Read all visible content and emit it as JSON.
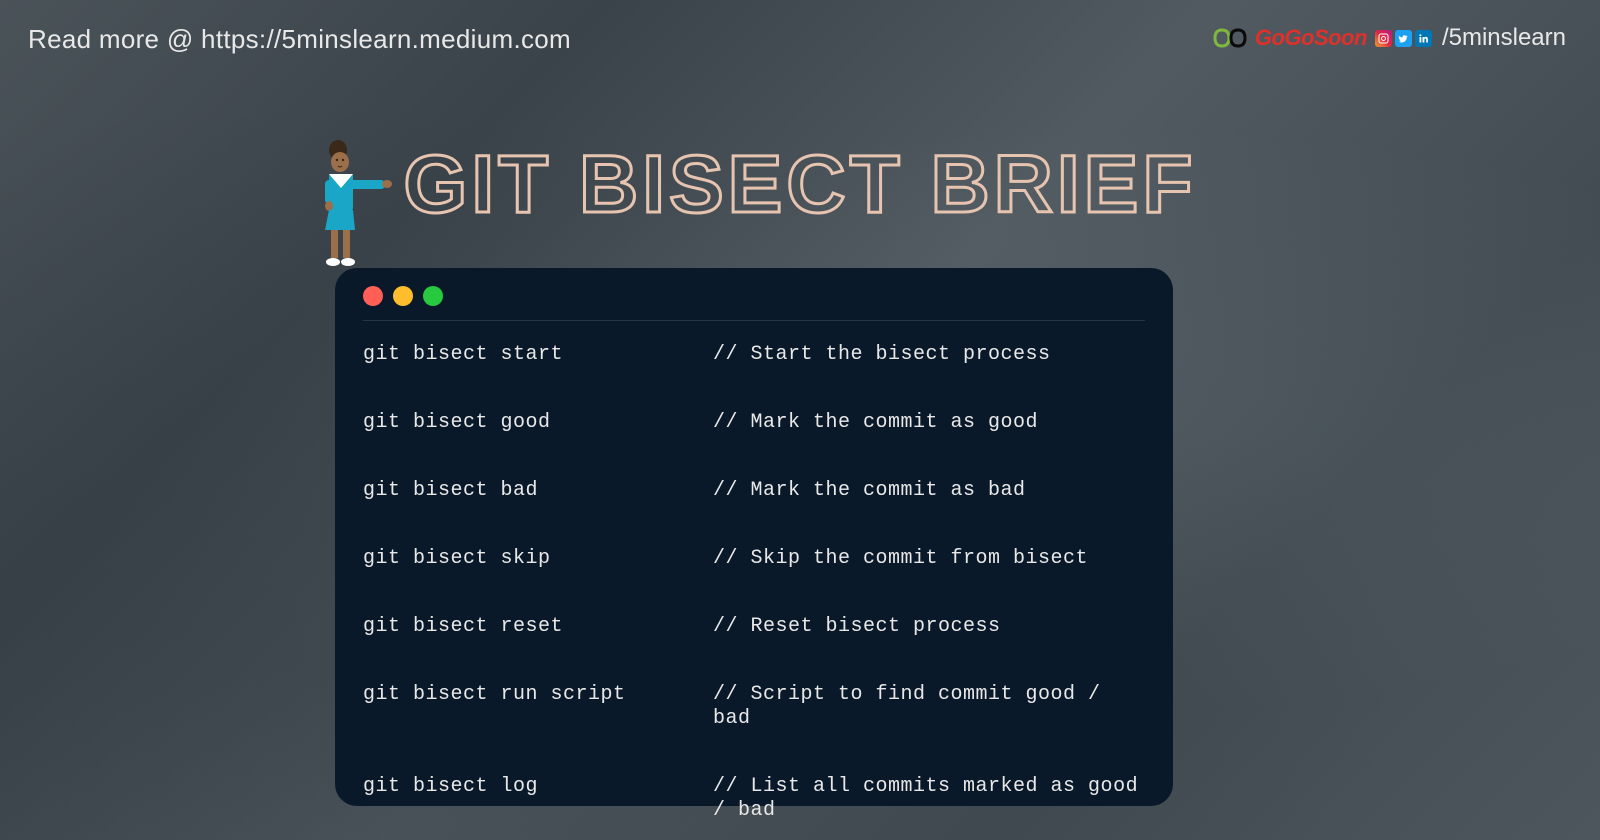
{
  "header": {
    "read_more": "Read more @ https://5minslearn.medium.com",
    "brand_name": "GoGoSoon",
    "social_handle": "/5minslearn"
  },
  "title": "GIT BISECT BRIEF",
  "window_controls": {
    "red": "#ff5f56",
    "yellow": "#ffbd2e",
    "green": "#27c93f"
  },
  "commands": [
    {
      "cmd": "git bisect start",
      "desc": "// Start the bisect process"
    },
    {
      "cmd": "git bisect good",
      "desc": "// Mark the commit as good"
    },
    {
      "cmd": "git bisect bad",
      "desc": "// Mark the commit as bad"
    },
    {
      "cmd": "git bisect skip",
      "desc": "// Skip the commit from bisect"
    },
    {
      "cmd": "git bisect reset",
      "desc": "// Reset bisect process"
    },
    {
      "cmd": "git bisect run script",
      "desc": "// Script to find commit good / bad"
    },
    {
      "cmd": "git bisect log",
      "desc": "// List all commits marked as good / bad"
    }
  ]
}
